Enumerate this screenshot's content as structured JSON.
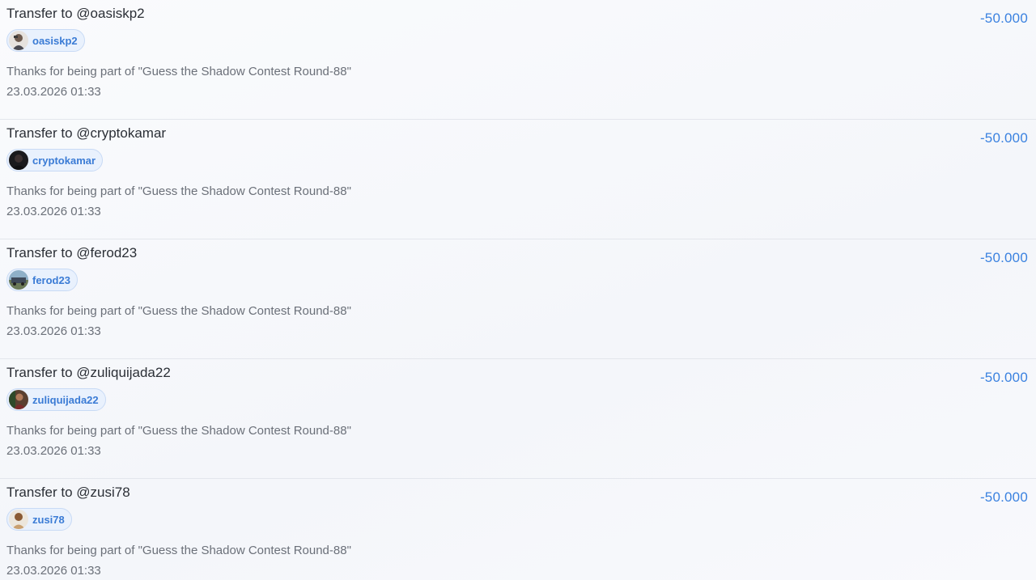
{
  "transactions": [
    {
      "title": "Transfer to @oasiskp2",
      "user": "oasiskp2",
      "avatar_icon": "user-avatar-oasiskp2",
      "memo": "Thanks for being part of \"Guess the Shadow Contest Round-88\"",
      "date": "23.03.2026 01:33",
      "amount": "-50.000"
    },
    {
      "title": "Transfer to @cryptokamar",
      "user": "cryptokamar",
      "avatar_icon": "user-avatar-cryptokamar",
      "memo": "Thanks for being part of \"Guess the Shadow Contest Round-88\"",
      "date": "23.03.2026 01:33",
      "amount": "-50.000"
    },
    {
      "title": "Transfer to @ferod23",
      "user": "ferod23",
      "avatar_icon": "user-avatar-ferod23",
      "memo": "Thanks for being part of \"Guess the Shadow Contest Round-88\"",
      "date": "23.03.2026 01:33",
      "amount": "-50.000"
    },
    {
      "title": "Transfer to @zuliquijada22",
      "user": "zuliquijada22",
      "avatar_icon": "user-avatar-zuliquijada22",
      "memo": "Thanks for being part of \"Guess the Shadow Contest Round-88\"",
      "date": "23.03.2026 01:33",
      "amount": "-50.000"
    },
    {
      "title": "Transfer to @zusi78",
      "user": "zusi78",
      "avatar_icon": "user-avatar-zusi78",
      "memo": "Thanks for being part of \"Guess the Shadow Contest Round-88\"",
      "date": "23.03.2026 01:33",
      "amount": "-50.000"
    }
  ],
  "colors": {
    "amount": "#3b82e0",
    "chip_bg": "#e9f1fd",
    "chip_text": "#3a7bd5"
  }
}
